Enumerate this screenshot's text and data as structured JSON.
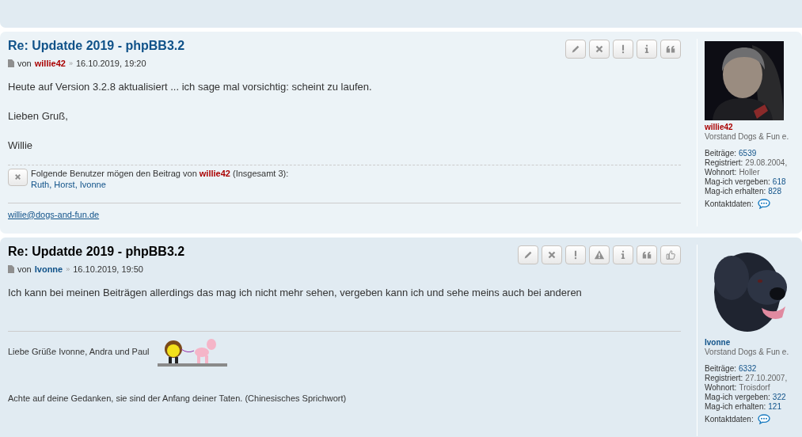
{
  "posts": [
    {
      "title": "Re: Updatde 2019 - phpBB3.2",
      "by": "von",
      "author": "willie42",
      "color": "#aa0000",
      "separator": "»",
      "date": "16.10.2019, 19:20",
      "buttons": [
        {
          "kind": "edit"
        },
        {
          "kind": "delete"
        },
        {
          "kind": "report"
        },
        {
          "kind": "info"
        },
        {
          "kind": "quote"
        }
      ],
      "body": [
        "Heute auf Version 3.2.8 aktualisiert ... ich sage mal vorsichtig: scheint zu laufen.",
        "Lieben Gruß,",
        "Willie"
      ],
      "likes": {
        "text": "Folgende Benutzer mögen den Beitrag von **willie42** (Insgesamt 3):",
        "names": "Ruth, Horst, Ivonne"
      },
      "signature": [
        {
          "kind": "link",
          "text": "willie@dogs-and-fun.de"
        }
      ],
      "profile": {
        "name": "willie42",
        "rank": "Vorstand Dogs & Fun e.",
        "fields": [
          {
            "label": "Beiträge:",
            "value": "6539",
            "kind": "link"
          },
          {
            "label": "Registriert:",
            "value": "29.08.2004,",
            "kind": "plain"
          },
          {
            "label": "Wohnort:",
            "value": "Holler",
            "kind": "plain"
          },
          {
            "label": "Mag-ich vergeben:",
            "value": "618",
            "kind": "link"
          },
          {
            "label": "Mag-ich erhalten:",
            "value": "828",
            "kind": "link"
          }
        ],
        "contact": "Kontaktdaten:"
      }
    },
    {
      "title": "Re: Updatde 2019 - phpBB3.2",
      "by": "von",
      "author": "Ivonne",
      "color": "#105289",
      "separator": "»",
      "date": "16.10.2019, 19:50",
      "buttons": [
        {
          "kind": "edit"
        },
        {
          "kind": "delete"
        },
        {
          "kind": "report"
        },
        {
          "kind": "warn"
        },
        {
          "kind": "info"
        },
        {
          "kind": "quote"
        },
        {
          "kind": "like"
        }
      ],
      "body": [
        "Ich kann bei meinen Beiträgen allerdings das mag ich nicht mehr sehen, vergeben kann ich und sehe meins auch bei anderen"
      ],
      "signature": [
        {
          "kind": "text",
          "text": "Liebe Grüße Ivonne, Andra und Paul",
          "picture": true
        },
        {
          "kind": "text",
          "text": "Achte auf deine Gedanken, sie sind der Anfang deiner Taten. (Chinesisches Sprichwort)"
        }
      ],
      "profile": {
        "name": "Ivonne",
        "rank": "Vorstand Dogs & Fun e.",
        "fields": [
          {
            "label": "Beiträge:",
            "value": "6332",
            "kind": "link"
          },
          {
            "label": "Registriert:",
            "value": "27.10.2007,",
            "kind": "plain"
          },
          {
            "label": "Wohnort:",
            "value": "Troisdorf",
            "kind": "plain"
          },
          {
            "label": "Mag-ich vergeben:",
            "value": "322",
            "kind": "link"
          },
          {
            "label": "Mag-ich erhalten:",
            "value": "121",
            "kind": "link"
          }
        ],
        "contact": "Kontaktdaten:"
      }
    }
  ]
}
